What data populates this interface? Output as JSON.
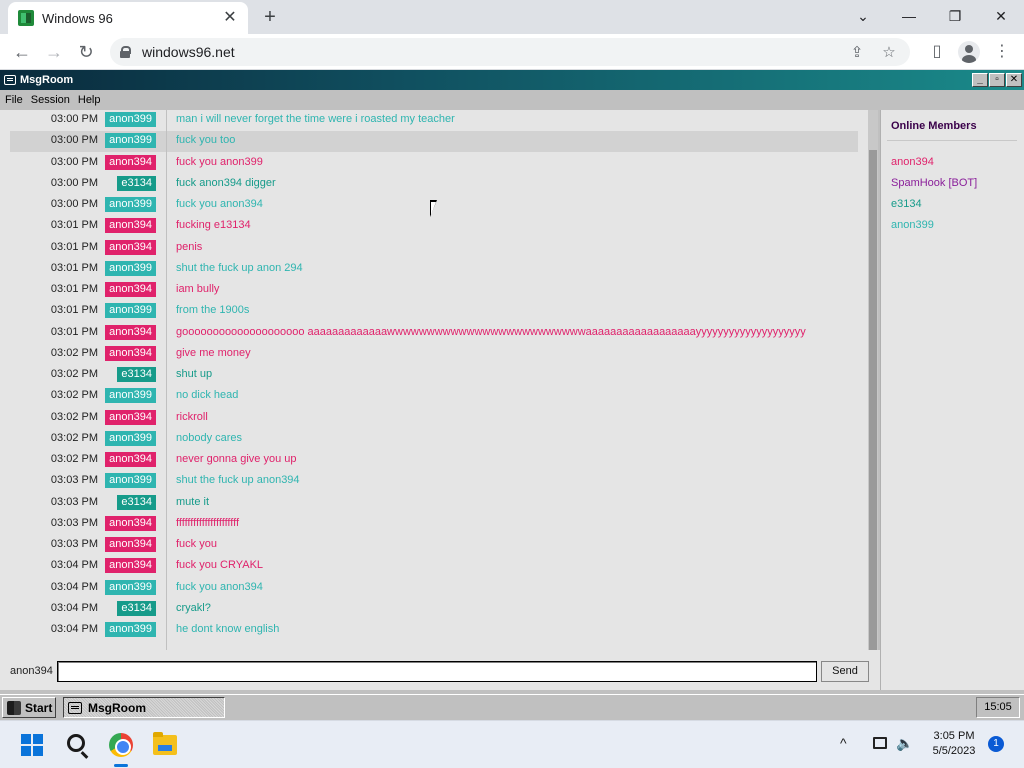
{
  "browser": {
    "tab_title": "Windows 96",
    "tab_close": "✕",
    "new_tab": "+",
    "url": "windows96.net",
    "window_min": "—",
    "window_restore": "❐",
    "window_close": "✕",
    "chevron": "⌄"
  },
  "window": {
    "title": "MsgRoom",
    "btn_min": "_",
    "btn_max": "▫",
    "btn_close": "✕"
  },
  "menu": {
    "items": [
      "File",
      "Session",
      "Help"
    ]
  },
  "colors": {
    "anon399": "#2fb5b0",
    "anon394": "#e0226b",
    "e3134": "#169b8a",
    "spamhook": "#8a1f9a",
    "members_title": "#3a004a"
  },
  "messages": [
    {
      "time": "03:00 PM",
      "user": "anon399",
      "text": "man i will never forget the time were i roasted my teacher"
    },
    {
      "time": "03:00 PM",
      "user": "anon399",
      "text": "fuck you too"
    },
    {
      "time": "03:00 PM",
      "user": "anon394",
      "text": "fuck you anon399"
    },
    {
      "time": "03:00 PM",
      "user": "e3134",
      "text": "fuck anon394 digger"
    },
    {
      "time": "03:00 PM",
      "user": "anon399",
      "text": "fuck you anon394"
    },
    {
      "time": "03:01 PM",
      "user": "anon394",
      "text": "fucking e13134"
    },
    {
      "time": "03:01 PM",
      "user": "anon394",
      "text": "penis"
    },
    {
      "time": "03:01 PM",
      "user": "anon399",
      "text": "shut the fuck up anon 294"
    },
    {
      "time": "03:01 PM",
      "user": "anon394",
      "text": "iam bully"
    },
    {
      "time": "03:01 PM",
      "user": "anon399",
      "text": "from the 1900s"
    },
    {
      "time": "03:01 PM",
      "user": "anon394",
      "text": "goooooooooooooooooooo aaaaaaaaaaaaawwwwwwwwwwwwwwwwwwwwwwwwwaaaaaaaaaaaaaaaaaayyyyyyyyyyyyyyyyyyyy"
    },
    {
      "time": "03:02 PM",
      "user": "anon394",
      "text": "give me money"
    },
    {
      "time": "03:02 PM",
      "user": "e3134",
      "text": "shut up"
    },
    {
      "time": "03:02 PM",
      "user": "anon399",
      "text": "no dick head"
    },
    {
      "time": "03:02 PM",
      "user": "anon394",
      "text": "rickroll"
    },
    {
      "time": "03:02 PM",
      "user": "anon399",
      "text": "nobody cares"
    },
    {
      "time": "03:02 PM",
      "user": "anon394",
      "text": "never gonna give you up"
    },
    {
      "time": "03:03 PM",
      "user": "anon399",
      "text": "shut the fuck up anon394"
    },
    {
      "time": "03:03 PM",
      "user": "e3134",
      "text": "mute it"
    },
    {
      "time": "03:03 PM",
      "user": "anon394",
      "text": "ffffffffffffffffffffff"
    },
    {
      "time": "03:03 PM",
      "user": "anon394",
      "text": "fuck you"
    },
    {
      "time": "03:04 PM",
      "user": "anon394",
      "text": "fuck you CRYAKL"
    },
    {
      "time": "03:04 PM",
      "user": "anon399",
      "text": "fuck you anon394"
    },
    {
      "time": "03:04 PM",
      "user": "e3134",
      "text": "cryakl?"
    },
    {
      "time": "03:04 PM",
      "user": "anon399",
      "text": "he dont know english"
    }
  ],
  "members": {
    "title": "Online Members",
    "list": [
      {
        "name": "anon394",
        "color_key": "anon394"
      },
      {
        "name": "SpamHook [BOT]",
        "color_key": "spamhook"
      },
      {
        "name": "e3134",
        "color_key": "e3134"
      },
      {
        "name": "anon399",
        "color_key": "anon399"
      }
    ]
  },
  "input": {
    "current_user": "anon394",
    "value": "",
    "send_label": "Send"
  },
  "win96_taskbar": {
    "start_label": "Start",
    "task_label": "MsgRoom",
    "clock": "15:05"
  },
  "win11_taskbar": {
    "time": "3:05 PM",
    "date": "5/5/2023",
    "notifications": "1",
    "chevron": "^",
    "volume": "🔈"
  }
}
